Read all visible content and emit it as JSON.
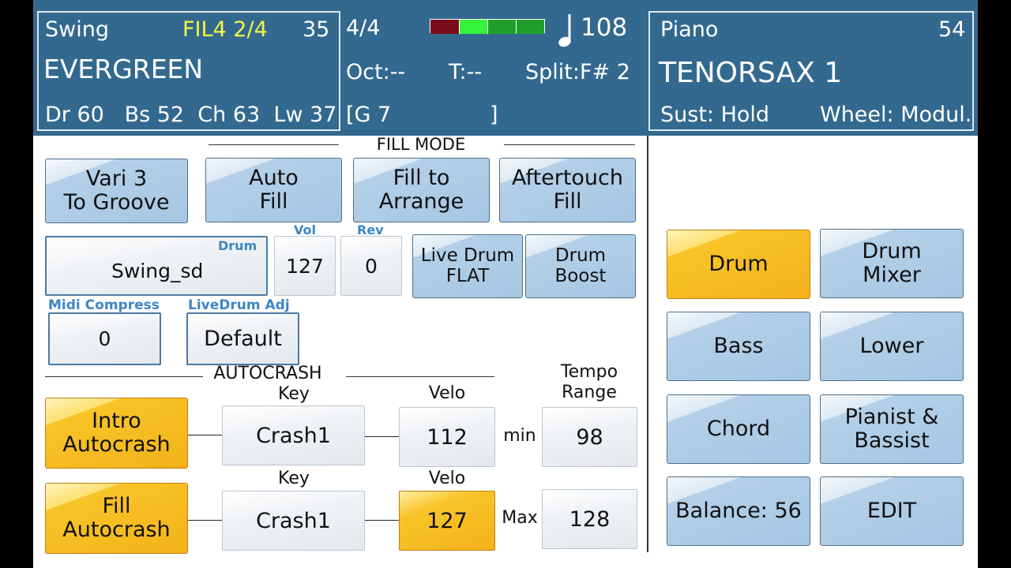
{
  "style_panel": {
    "style_name": "Swing",
    "fill_variation": "FIL4 2/4",
    "style_number": "35",
    "song_name": "EVERGREEN",
    "parts": "Dr 60   Bs 52  Ch 63  Lw 37"
  },
  "center_panel": {
    "time_signature": "4/4",
    "tempo": "108",
    "octave": "Oct:--",
    "transpose": "T:--",
    "split": "Split:F# 2",
    "chord": "[G 7",
    "chord_close": "]",
    "beat_colors": [
      "#7a0c1a",
      "#37f23a",
      "#1f9e2c",
      "#1f9e2c"
    ]
  },
  "voice_panel": {
    "voice_category": "Piano",
    "voice_number": "54",
    "voice_name": "TENORSAX 1",
    "sustain": "Sust: Hold",
    "wheel": "Wheel: Modul."
  },
  "fill_mode": {
    "title": "FILL MODE",
    "buttons": [
      "Vari 3\nTo Groove",
      "Auto\nFill",
      "Fill to\nArrange",
      "Aftertouch\nFill"
    ]
  },
  "drum": {
    "label": "Drum",
    "kit": "Swing_sd",
    "vol_label": "Vol",
    "vol": "127",
    "rev_label": "Rev",
    "rev": "0",
    "live_drum_flat": "Live Drum\nFLAT",
    "drum_boost": "Drum\nBoost",
    "midi_compress_label": "Midi Compress",
    "midi_compress": "0",
    "livedrum_adj_label": "LiveDrum Adj",
    "livedrum_adj": "Default"
  },
  "autocrash": {
    "title": "AUTOCRASH",
    "tempo_range_label": "Tempo\nRange",
    "key_label": "Key",
    "velo_label": "Velo",
    "min_label": "min",
    "max_label": "Max",
    "intro_button": "Intro\nAutocrash",
    "intro_key": "Crash1",
    "intro_velo": "112",
    "tempo_min": "98",
    "fill_button": "Fill\nAutocrash",
    "fill_key": "Crash1",
    "fill_velo": "127",
    "tempo_max": "128"
  },
  "right_menu": {
    "buttons": [
      "Drum",
      "Drum\nMixer",
      "Bass",
      "Lower",
      "Chord",
      "Pianist &\nBassist",
      "Balance: 56",
      "EDIT"
    ],
    "active": "Drum"
  }
}
